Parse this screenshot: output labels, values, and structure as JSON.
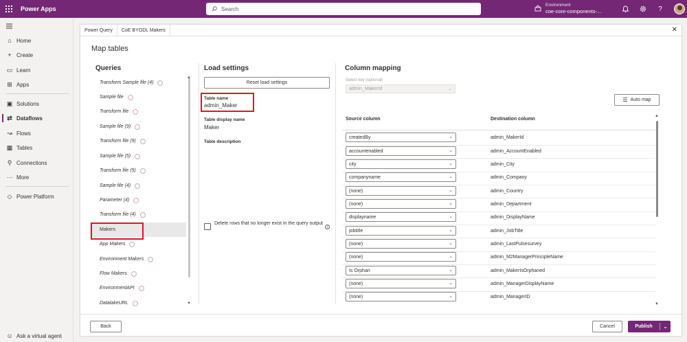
{
  "topbar": {
    "app_title": "Power Apps",
    "search_placeholder": "Search",
    "environment_label": "Environment",
    "environment_name": "coe-core-components-..."
  },
  "nav": {
    "items": [
      {
        "label": "Home",
        "icon": "home-icon"
      },
      {
        "label": "Create",
        "icon": "plus-icon"
      },
      {
        "label": "Learn",
        "icon": "book-icon"
      },
      {
        "label": "Apps",
        "icon": "apps-icon"
      },
      {
        "label": "Solutions",
        "icon": "solutions-icon"
      },
      {
        "label": "Dataflows",
        "icon": "dataflows-icon"
      },
      {
        "label": "Flows",
        "icon": "flows-icon"
      },
      {
        "label": "Tables",
        "icon": "table-icon"
      },
      {
        "label": "Connections",
        "icon": "plug-icon"
      },
      {
        "label": "More",
        "icon": "more-icon"
      },
      {
        "label": "Power Platform",
        "icon": "power-platform-icon"
      }
    ],
    "virtual_agent": "Ask a virtual agent"
  },
  "dialog": {
    "tabs": [
      "Power Query",
      "CoE BYODL Makers"
    ],
    "title": "Map tables"
  },
  "queries": {
    "title": "Queries",
    "items": [
      "Transform Sample file (4)",
      "Sample file",
      "Transform file",
      "Sample file (9)",
      "Transform file (9)",
      "Sample file (5)",
      "Transform file (5)",
      "Sample file (4)",
      "Parameter (4)",
      "Transform file (4)",
      "Makers",
      "App Makers",
      "Environment Makers",
      "Flow Makers",
      "EnvironmentAPI",
      "DatalakeURL"
    ]
  },
  "load_settings": {
    "title": "Load settings",
    "reset_label": "Reset load settings",
    "table_name_label": "Table name",
    "table_name_value": "admin_Maker",
    "display_name_label": "Table display name",
    "display_name_value": "Maker",
    "description_label": "Table description",
    "delete_rows_label": "Delete rows that no longer exist in the query output"
  },
  "column_mapping": {
    "title": "Column mapping",
    "select_key_label": "Select key (optional)",
    "select_key_value": "admin_MakerId",
    "auto_map_label": "Auto map",
    "source_header": "Source column",
    "destination_header": "Destination column",
    "rows": [
      {
        "source": "createdBy",
        "dest": "admin_MakerId"
      },
      {
        "source": "accountenabled",
        "dest": "admin_AccountEnabled"
      },
      {
        "source": "city",
        "dest": "admin_City"
      },
      {
        "source": "companyname",
        "dest": "admin_Company"
      },
      {
        "source": "(none)",
        "dest": "admin_Country"
      },
      {
        "source": "(none)",
        "dest": "admin_Department"
      },
      {
        "source": "displayname",
        "dest": "admin_DisplayName"
      },
      {
        "source": "jobtitle",
        "dest": "admin_JobTitle"
      },
      {
        "source": "(none)",
        "dest": "admin_LastPulsesurvey"
      },
      {
        "source": "(none)",
        "dest": "admin_M2ManagerPrincipleName"
      },
      {
        "source": "Is Orphan",
        "dest": "admin_MakerIsOrphaned"
      },
      {
        "source": "(none)",
        "dest": "admin_ManagerDisplayName"
      },
      {
        "source": "(none)",
        "dest": "admin_ManagerID"
      }
    ]
  },
  "footer": {
    "back_label": "Back",
    "cancel_label": "Cancel",
    "publish_label": "Publish"
  },
  "colors": {
    "brand": "#742774",
    "highlight": "#e81123"
  }
}
